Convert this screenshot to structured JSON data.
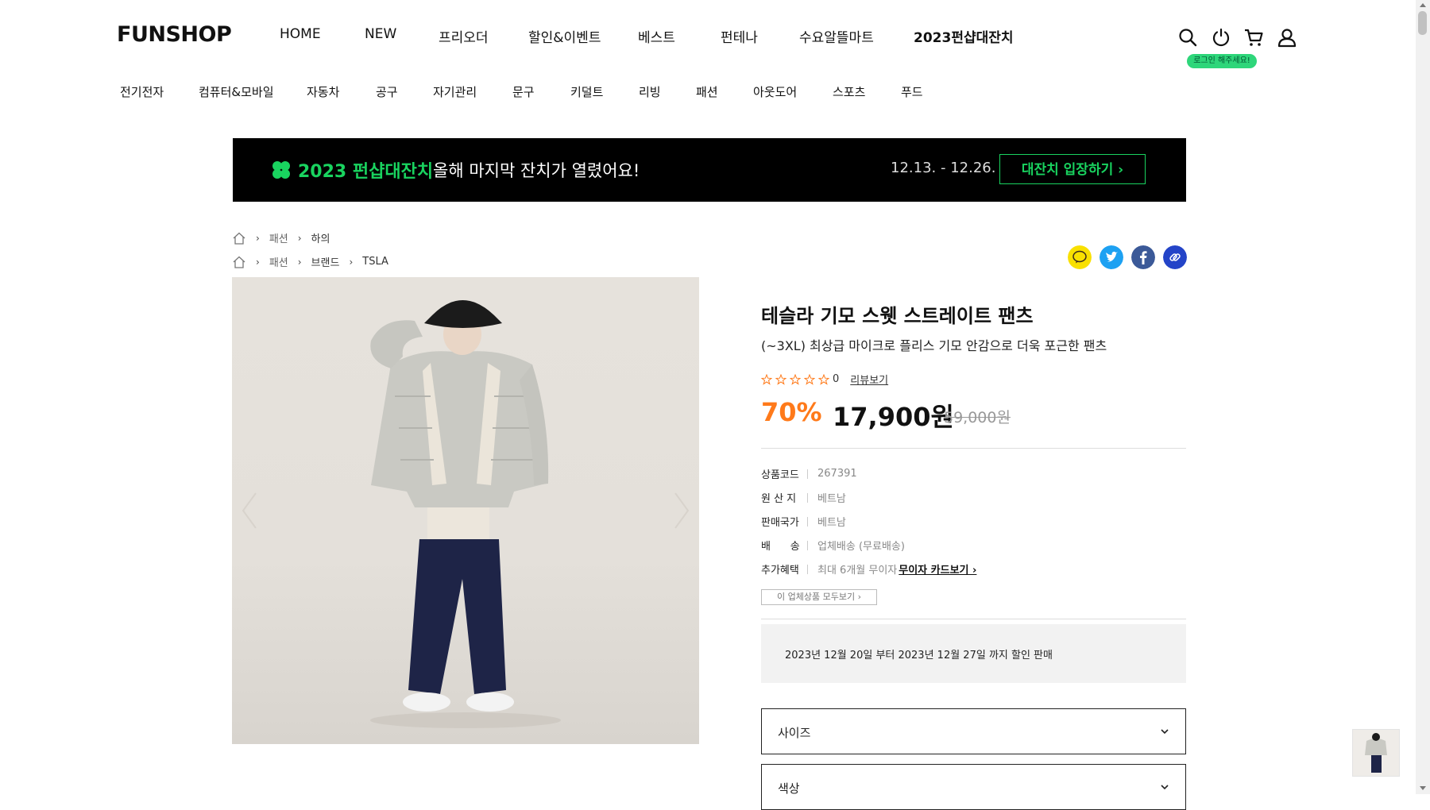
{
  "header": {
    "logo": "FUNSHOP",
    "nav": [
      "HOME",
      "NEW",
      "프리오더",
      "할인&이벤트",
      "베스트",
      "펀테나",
      "수요알뜰마트",
      "2023펀샵대잔치"
    ],
    "login_badge": "로그인 해주세요!",
    "icons": [
      "search-icon",
      "power-icon",
      "cart-icon",
      "user-icon"
    ]
  },
  "categories": [
    "전기전자",
    "컴퓨터&모바일",
    "자동차",
    "공구",
    "자기관리",
    "문구",
    "키덜트",
    "리빙",
    "패션",
    "아웃도어",
    "스포츠",
    "푸드"
  ],
  "banner": {
    "title": "2023 펀샵대잔치",
    "subtitle": "올해 마지막 잔치가 열렸어요!",
    "dates": "12.13. - 12.26.",
    "button": "대잔치 입장하기 ›",
    "accent_color": "#19d35f"
  },
  "breadcrumbs": [
    [
      "패션",
      "하의"
    ],
    [
      "패션",
      "브랜드",
      "TSLA"
    ]
  ],
  "share": [
    "kakao-icon",
    "twitter-icon",
    "facebook-icon",
    "link-icon"
  ],
  "product": {
    "title": "테슬라 기모 스웻 스트레이트 팬츠",
    "subtitle": "(~3XL) 최상급 마이크로 플리스 기모 안감으로 더욱 포근한 팬츠",
    "rating_count": "0",
    "review_link": "리뷰보기",
    "discount": "70%",
    "price": "17,900원",
    "original_price": "59,000원",
    "specs": [
      {
        "label": "상품코드",
        "value": "267391"
      },
      {
        "label": "원 산 지",
        "value": "베트남"
      },
      {
        "label": "판매국가",
        "value": "베트남"
      },
      {
        "label": "배      송",
        "value": "업체배송 (무료배송)"
      },
      {
        "label": "추가혜택",
        "value": "최대 6개월 무이자",
        "link": "무이자 카드보기 ›"
      }
    ],
    "seller_button": "이 업체상품 모두보기 ›",
    "sale_period": "2023년 12월 20일 부터 2023년 12월 27일 까지 할인 판매",
    "options": [
      "사이즈",
      "색상"
    ]
  },
  "colors": {
    "discount": "#ff7a1a",
    "accent": "#19c35a"
  }
}
